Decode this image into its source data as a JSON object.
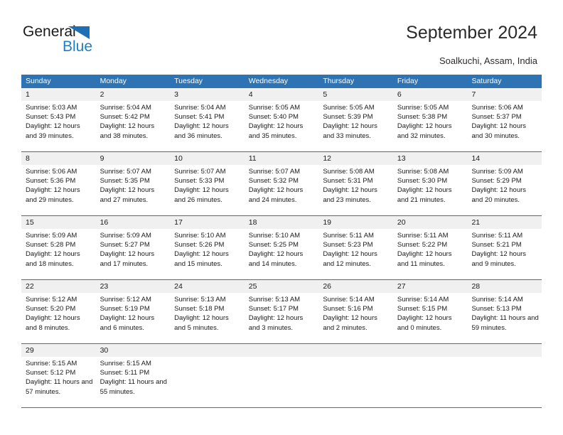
{
  "brand": {
    "name_primary": "General",
    "name_secondary": "Blue",
    "accent_color": "#1F7FC4"
  },
  "header": {
    "title": "September 2024",
    "subtitle": "Soalkuchi, Assam, India"
  },
  "theme": {
    "header_blue": "#2E74B5",
    "day_band_gray": "#F0F0F0",
    "text_color": "#1a1a1a"
  },
  "weekdays": [
    {
      "label": "Sunday"
    },
    {
      "label": "Monday"
    },
    {
      "label": "Tuesday"
    },
    {
      "label": "Wednesday"
    },
    {
      "label": "Thursday"
    },
    {
      "label": "Friday"
    },
    {
      "label": "Saturday"
    }
  ],
  "weeks": [
    {
      "days": [
        {
          "day": "1",
          "sunrise": "Sunrise: 5:03 AM",
          "sunset": "Sunset: 5:43 PM",
          "daylight": "Daylight: 12 hours and 39 minutes."
        },
        {
          "day": "2",
          "sunrise": "Sunrise: 5:04 AM",
          "sunset": "Sunset: 5:42 PM",
          "daylight": "Daylight: 12 hours and 38 minutes."
        },
        {
          "day": "3",
          "sunrise": "Sunrise: 5:04 AM",
          "sunset": "Sunset: 5:41 PM",
          "daylight": "Daylight: 12 hours and 36 minutes."
        },
        {
          "day": "4",
          "sunrise": "Sunrise: 5:05 AM",
          "sunset": "Sunset: 5:40 PM",
          "daylight": "Daylight: 12 hours and 35 minutes."
        },
        {
          "day": "5",
          "sunrise": "Sunrise: 5:05 AM",
          "sunset": "Sunset: 5:39 PM",
          "daylight": "Daylight: 12 hours and 33 minutes."
        },
        {
          "day": "6",
          "sunrise": "Sunrise: 5:05 AM",
          "sunset": "Sunset: 5:38 PM",
          "daylight": "Daylight: 12 hours and 32 minutes."
        },
        {
          "day": "7",
          "sunrise": "Sunrise: 5:06 AM",
          "sunset": "Sunset: 5:37 PM",
          "daylight": "Daylight: 12 hours and 30 minutes."
        }
      ]
    },
    {
      "days": [
        {
          "day": "8",
          "sunrise": "Sunrise: 5:06 AM",
          "sunset": "Sunset: 5:36 PM",
          "daylight": "Daylight: 12 hours and 29 minutes."
        },
        {
          "day": "9",
          "sunrise": "Sunrise: 5:07 AM",
          "sunset": "Sunset: 5:35 PM",
          "daylight": "Daylight: 12 hours and 27 minutes."
        },
        {
          "day": "10",
          "sunrise": "Sunrise: 5:07 AM",
          "sunset": "Sunset: 5:33 PM",
          "daylight": "Daylight: 12 hours and 26 minutes."
        },
        {
          "day": "11",
          "sunrise": "Sunrise: 5:07 AM",
          "sunset": "Sunset: 5:32 PM",
          "daylight": "Daylight: 12 hours and 24 minutes."
        },
        {
          "day": "12",
          "sunrise": "Sunrise: 5:08 AM",
          "sunset": "Sunset: 5:31 PM",
          "daylight": "Daylight: 12 hours and 23 minutes."
        },
        {
          "day": "13",
          "sunrise": "Sunrise: 5:08 AM",
          "sunset": "Sunset: 5:30 PM",
          "daylight": "Daylight: 12 hours and 21 minutes."
        },
        {
          "day": "14",
          "sunrise": "Sunrise: 5:09 AM",
          "sunset": "Sunset: 5:29 PM",
          "daylight": "Daylight: 12 hours and 20 minutes."
        }
      ]
    },
    {
      "days": [
        {
          "day": "15",
          "sunrise": "Sunrise: 5:09 AM",
          "sunset": "Sunset: 5:28 PM",
          "daylight": "Daylight: 12 hours and 18 minutes."
        },
        {
          "day": "16",
          "sunrise": "Sunrise: 5:09 AM",
          "sunset": "Sunset: 5:27 PM",
          "daylight": "Daylight: 12 hours and 17 minutes."
        },
        {
          "day": "17",
          "sunrise": "Sunrise: 5:10 AM",
          "sunset": "Sunset: 5:26 PM",
          "daylight": "Daylight: 12 hours and 15 minutes."
        },
        {
          "day": "18",
          "sunrise": "Sunrise: 5:10 AM",
          "sunset": "Sunset: 5:25 PM",
          "daylight": "Daylight: 12 hours and 14 minutes."
        },
        {
          "day": "19",
          "sunrise": "Sunrise: 5:11 AM",
          "sunset": "Sunset: 5:23 PM",
          "daylight": "Daylight: 12 hours and 12 minutes."
        },
        {
          "day": "20",
          "sunrise": "Sunrise: 5:11 AM",
          "sunset": "Sunset: 5:22 PM",
          "daylight": "Daylight: 12 hours and 11 minutes."
        },
        {
          "day": "21",
          "sunrise": "Sunrise: 5:11 AM",
          "sunset": "Sunset: 5:21 PM",
          "daylight": "Daylight: 12 hours and 9 minutes."
        }
      ]
    },
    {
      "days": [
        {
          "day": "22",
          "sunrise": "Sunrise: 5:12 AM",
          "sunset": "Sunset: 5:20 PM",
          "daylight": "Daylight: 12 hours and 8 minutes."
        },
        {
          "day": "23",
          "sunrise": "Sunrise: 5:12 AM",
          "sunset": "Sunset: 5:19 PM",
          "daylight": "Daylight: 12 hours and 6 minutes."
        },
        {
          "day": "24",
          "sunrise": "Sunrise: 5:13 AM",
          "sunset": "Sunset: 5:18 PM",
          "daylight": "Daylight: 12 hours and 5 minutes."
        },
        {
          "day": "25",
          "sunrise": "Sunrise: 5:13 AM",
          "sunset": "Sunset: 5:17 PM",
          "daylight": "Daylight: 12 hours and 3 minutes."
        },
        {
          "day": "26",
          "sunrise": "Sunrise: 5:14 AM",
          "sunset": "Sunset: 5:16 PM",
          "daylight": "Daylight: 12 hours and 2 minutes."
        },
        {
          "day": "27",
          "sunrise": "Sunrise: 5:14 AM",
          "sunset": "Sunset: 5:15 PM",
          "daylight": "Daylight: 12 hours and 0 minutes."
        },
        {
          "day": "28",
          "sunrise": "Sunrise: 5:14 AM",
          "sunset": "Sunset: 5:13 PM",
          "daylight": "Daylight: 11 hours and 59 minutes."
        }
      ]
    },
    {
      "days": [
        {
          "day": "29",
          "sunrise": "Sunrise: 5:15 AM",
          "sunset": "Sunset: 5:12 PM",
          "daylight": "Daylight: 11 hours and 57 minutes."
        },
        {
          "day": "30",
          "sunrise": "Sunrise: 5:15 AM",
          "sunset": "Sunset: 5:11 PM",
          "daylight": "Daylight: 11 hours and 55 minutes."
        },
        {
          "day": "",
          "sunrise": "",
          "sunset": "",
          "daylight": ""
        },
        {
          "day": "",
          "sunrise": "",
          "sunset": "",
          "daylight": ""
        },
        {
          "day": "",
          "sunrise": "",
          "sunset": "",
          "daylight": ""
        },
        {
          "day": "",
          "sunrise": "",
          "sunset": "",
          "daylight": ""
        },
        {
          "day": "",
          "sunrise": "",
          "sunset": "",
          "daylight": ""
        }
      ]
    }
  ]
}
